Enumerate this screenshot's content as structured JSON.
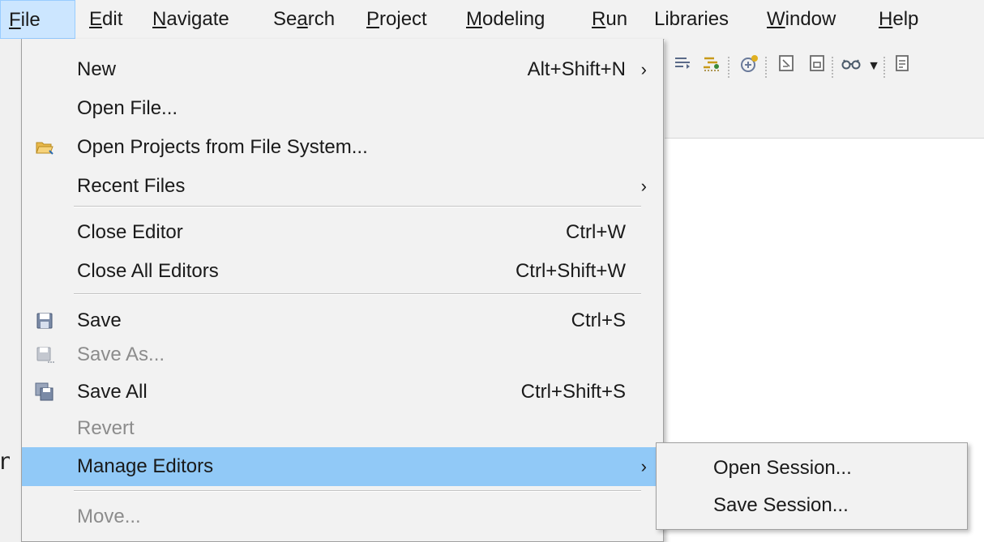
{
  "menubar": {
    "items": [
      {
        "label": "File",
        "mnemonic": "F",
        "rest": "ile"
      },
      {
        "label": "Edit",
        "mnemonic": "E",
        "rest": "dit"
      },
      {
        "label": "Navigate",
        "mnemonic": "N",
        "rest": "avigate"
      },
      {
        "label": "Search",
        "pre": "Se",
        "mnemonic": "a",
        "rest": "rch"
      },
      {
        "label": "Project",
        "mnemonic": "P",
        "rest": "roject"
      },
      {
        "label": "Modeling",
        "mnemonic": "M",
        "rest": "odeling"
      },
      {
        "label": "Run",
        "mnemonic": "R",
        "rest": "un"
      },
      {
        "label": "Libraries"
      },
      {
        "label": "Window",
        "mnemonic": "W",
        "rest": "indow"
      },
      {
        "label": "Help",
        "mnemonic": "H",
        "rest": "elp"
      }
    ]
  },
  "file_menu": {
    "items": [
      {
        "label": "New",
        "shortcut": "Alt+Shift+N",
        "submenu_arrow": "›"
      },
      {
        "label": "Open File..."
      },
      {
        "label": "Open Projects from File System...",
        "icon": "folder-open-icon"
      },
      {
        "label": "Recent Files",
        "submenu_arrow": "›"
      },
      {
        "label": "Close Editor",
        "shortcut": "Ctrl+W"
      },
      {
        "label": "Close All Editors",
        "shortcut": "Ctrl+Shift+W"
      },
      {
        "label": "Save",
        "shortcut": "Ctrl+S",
        "icon": "save-icon"
      },
      {
        "label": "Save As...",
        "disabled": true,
        "icon": "save-as-icon"
      },
      {
        "label": "Save All",
        "shortcut": "Ctrl+Shift+S",
        "icon": "save-all-icon"
      },
      {
        "label": "Revert",
        "disabled": true
      },
      {
        "label": "Manage Editors",
        "submenu_arrow": "›",
        "highlighted": true
      },
      {
        "label": "Move...",
        "disabled": true
      }
    ]
  },
  "manage_editors_submenu": {
    "items": [
      {
        "label": "Open Session..."
      },
      {
        "label": "Save Session..."
      }
    ]
  },
  "toolbar": {
    "icons": [
      "toolbar-icon-1",
      "toolbar-icon-2",
      "toolbar-icon-3",
      "toolbar-icon-4",
      "toolbar-icon-5",
      "toolbar-icon-6",
      "dropdown-arrow-icon",
      "toolbar-icon-7"
    ]
  },
  "colors": {
    "highlight": "#91c9f7",
    "menu_bg": "#f2f2f2",
    "active_title": "#cce6ff",
    "disabled_text": "#8c8c8c"
  }
}
